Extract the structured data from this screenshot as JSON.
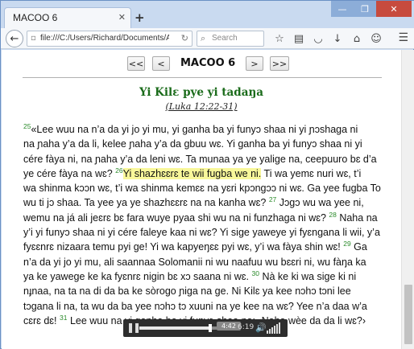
{
  "browser": {
    "tab_title": "MACOO 6",
    "tab_close": "✕",
    "new_tab": "+",
    "url": "file:///C:/Users/Richard/Documents/App Bui",
    "search_placeholder": "Search",
    "window_min": "—",
    "window_max": "❐",
    "window_close": "✕"
  },
  "page": {
    "nav_first": "<<",
    "nav_prev": "<",
    "nav_next": ">",
    "nav_last": ">>",
    "chapter_title": "MACOO 6",
    "section_heading": "Yi Kilɛ pye yi tadaŋa",
    "section_ref": "(Luka 12:22-31)"
  },
  "text": {
    "v25": "25",
    "l1": "«Lee wuu na n’a da yi jo yi mu, yi ganha ba yi funyɔ shaa ni yi ɲɔshaga ni",
    "l2": "na ɲaha y’a da li, kelee ɲaha y’a da gbuu wɛ. Yi ganha ba yi funyɔ shaa ni yi",
    "l3": "cére fàya ni, na ɲaha y’a da leni wɛ. Ta munaa ya ye yalige na, ceepuuro bɛ d’a",
    "l4a": "ye cére fàya na wɛ?",
    "v26": "26",
    "l4hl": "Yi shazhɛɛrɛ te wii fugba we ni.",
    "l4b": " Ti wa yemɛ nuri wɛ, t’i",
    "l5": "wa shinma kɔɔn wɛ, t’i wa shinma kemɛɛ na yɛri kpɔngɔɔ ni wɛ. Ga yee fugba To",
    "l6a": "wu ti jɔ shaa. Ta yee ya ye shazhɛɛrɛ na na kanha wɛ?",
    "v27": "27",
    "l6b": " Jɔgɔ wu wa yee ni,",
    "l7a": "wemu na já ali jeɛrɛ bɛ fara wuye pyaa shi wu na ni funzhaga ni wɛ?",
    "v28": "28",
    "l7b": " Naha na",
    "l8": "y’i yi funyɔ shaa ni yi cére faleye kaa ni wɛ? Yi sige yaweye yi fyɛngana li wii, y’a",
    "l9a": "fyɛɛnrɛ nizaara temu pyi ge! Yi wa kapyeŋɛɛ pyi wɛ, y’i wa fàya shin wɛ!",
    "v29": "29",
    "l9b": " Ga",
    "l10": "n’a da yi jo yi mu, ali saannaa Solomanii ni wu naafuu wu bɛɛri ni, wu fàŋa ka",
    "l11a": "ya ke yawege ke ka fyɛnrɛ nigin bɛ xɔ saana ni wɛ.",
    "v30": "30",
    "l11b": " Nà ke ki wa sige ki ni",
    "l12": "nɟnaa, na ta na di da ba ke sòrogo ɲiga na ge. Ni Kilɛ ya kee nɔhɔ tɔni lee",
    "l13": "tɔgana li na, ta wu da ba yee nɔhɔ tɔ xuuni na ye kee na wɛ? Yee n’a daa w’a",
    "l14a": "cɛrɛ dɛ!",
    "v31": "31",
    "l14b": " Lee wuu na yi ganha ba yi funyɔ shaa na: ‹Naha wèe da da li wɛ?›"
  },
  "player": {
    "pause_icon": "❚❚",
    "current_time": "4:42",
    "duration": "6:19",
    "progress": 0.742,
    "volume_icon": "🔊"
  }
}
